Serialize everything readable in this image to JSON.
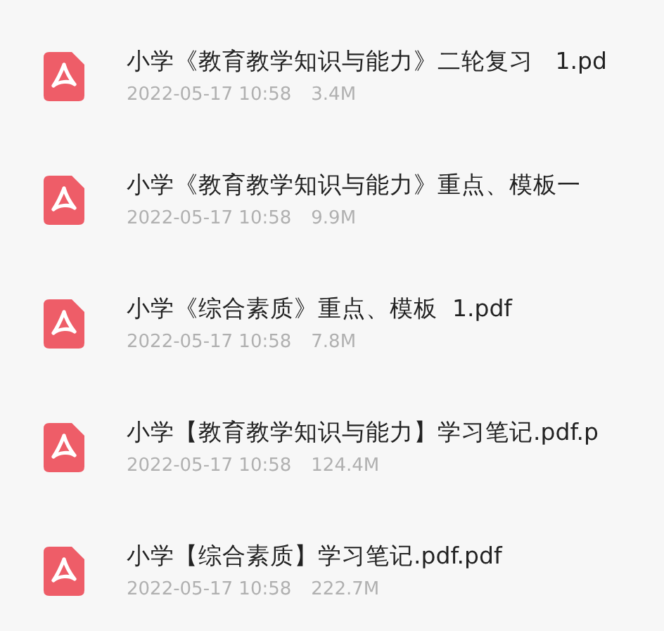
{
  "files": [
    {
      "name": "小学《教育教学知识与能力》二轮复习   1.pd",
      "date": "2022-05-17 10:58",
      "size": "3.4M"
    },
    {
      "name": "小学《教育教学知识与能力》重点、模板一",
      "date": "2022-05-17 10:58",
      "size": "9.9M"
    },
    {
      "name": "小学《综合素质》重点、模板  1.pdf",
      "date": "2022-05-17 10:58",
      "size": "7.8M"
    },
    {
      "name": "小学【教育教学知识与能力】学习笔记.pdf.p",
      "date": "2022-05-17 10:58",
      "size": "124.4M"
    },
    {
      "name": "小学【综合素质】学习笔记.pdf.pdf",
      "date": "2022-05-17 10:58",
      "size": "222.7M"
    }
  ]
}
